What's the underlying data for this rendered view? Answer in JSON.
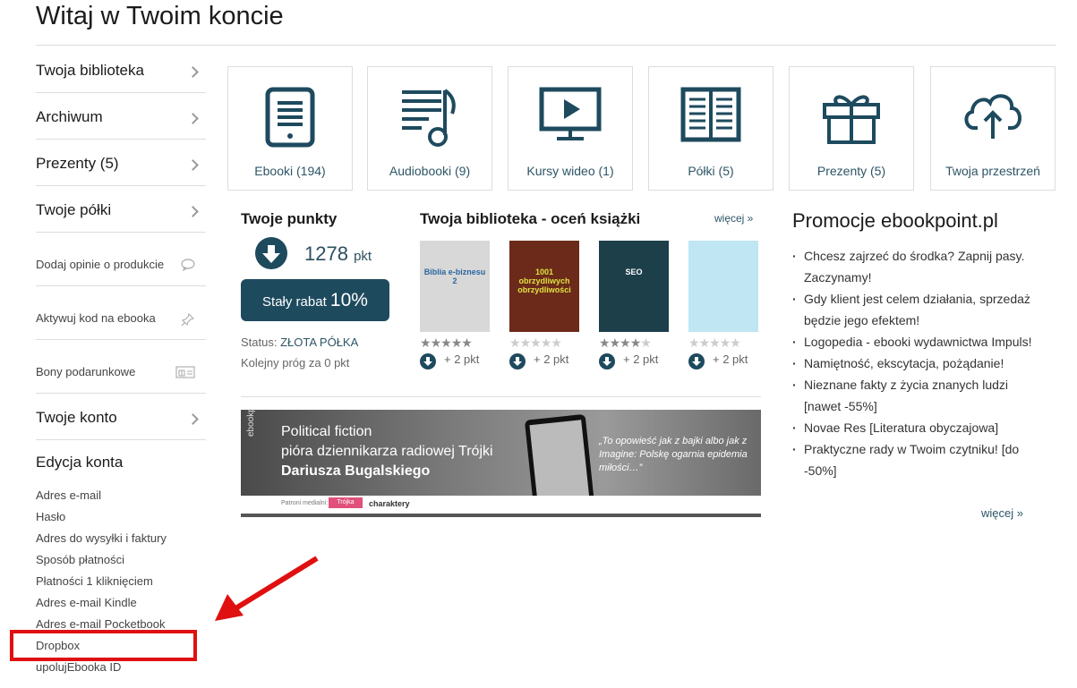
{
  "page": {
    "title": "Witaj w Twoim koncie"
  },
  "sidebar": {
    "items": [
      {
        "label": "Twoja biblioteka",
        "type": "big"
      },
      {
        "label": "Archiwum",
        "type": "big"
      },
      {
        "label": "Prezenty (5)",
        "type": "big"
      },
      {
        "label": "Twoje półki",
        "type": "big"
      },
      {
        "label": "Dodaj opinie o produkcie",
        "type": "small",
        "icon": "comment-icon"
      },
      {
        "label": "Aktywuj kod na ebooka",
        "type": "small",
        "icon": "pin-icon"
      },
      {
        "label": "Bony podarunkowe",
        "type": "small",
        "icon": "gift-card-icon"
      },
      {
        "label": "Twoje konto",
        "type": "big"
      }
    ],
    "account_heading": "Edycja konta",
    "account_links": [
      "Adres e-mail",
      "Hasło",
      "Adres do wysyłki i faktury",
      "Sposób płatności",
      "Płatności 1 kliknięciem",
      "Adres e-mail Kindle",
      "Adres e-mail Pocketbook",
      "Dropbox",
      "upolujEbooka ID"
    ]
  },
  "tiles": [
    {
      "label": "Ebooki (194)",
      "icon": "ebook-icon"
    },
    {
      "label": "Audiobooki (9)",
      "icon": "audiobook-icon"
    },
    {
      "label": "Kursy wideo (1)",
      "icon": "video-icon"
    },
    {
      "label": "Półki (5)",
      "icon": "shelves-icon"
    },
    {
      "label": "Prezenty (5)",
      "icon": "gift-icon"
    },
    {
      "label": "Twoja przestrzeń",
      "icon": "cloud-upload-icon"
    }
  ],
  "points": {
    "title": "Twoje punkty",
    "value": "1278",
    "unit": "pkt",
    "discount_prefix": "Stały rabat",
    "discount_value": "10%",
    "status_label": "Status:",
    "status_value": "ZŁOTA PÓŁKA",
    "next_threshold": "Kolejny próg za 0 pkt"
  },
  "library": {
    "title": "Twoja biblioteka - oceń książki",
    "more": "więcej »",
    "books": [
      {
        "cover_text": "Biblia e-biznesu 2",
        "rating": 4.5,
        "points": "+ 2 pkt",
        "bg": "#d8d8d8",
        "fg": "#2a66a0"
      },
      {
        "cover_text": "1001 obrzydliwych obrzydliwości",
        "rating": 0,
        "points": "+ 2 pkt",
        "bg": "#6b2a1a",
        "fg": "#e0e040"
      },
      {
        "cover_text": "SEO",
        "rating": 4,
        "points": "+ 2 pkt",
        "bg": "#1c3f4a",
        "fg": "#ffffff"
      },
      {
        "cover_text": "",
        "rating": 0,
        "points": "+ 2 pkt",
        "bg": "#bfe6f2",
        "fg": "#c03030"
      }
    ]
  },
  "banner": {
    "brand": "ebookpoint®",
    "line1": "Political fiction",
    "line2": "pióra dziennikarza radiowej Trójki",
    "line3": "Dariusza Bugalskiego",
    "quote": "„To opowieść jak z bajki albo jak z Imagine: Polskę ogarnia epidemia miłości…”",
    "patron": "Patroni medialni:",
    "logo1": "Trójka",
    "logo2": "charaktery"
  },
  "promo": {
    "title": "Promocje ebookpoint.pl",
    "items": [
      "Chcesz zajrzeć do środka? Zapnij pasy. Zaczynamy!",
      "Gdy klient jest celem działania, sprzedaż będzie jego efektem!",
      "Logopedia - ebooki wydawnictwa Impuls!",
      "Namiętność, ekscytacja, pożądanie!",
      "Nieznane fakty z życia znanych ludzi [nawet -55%]",
      "Novae Res [Literatura obyczajowa]",
      "Praktyczne rady w Twoim czytniku! [do -50%]"
    ],
    "more": "więcej »"
  },
  "colors": {
    "accent": "#1e4a5e",
    "link": "#2c5566",
    "annotation": "#e01010"
  }
}
